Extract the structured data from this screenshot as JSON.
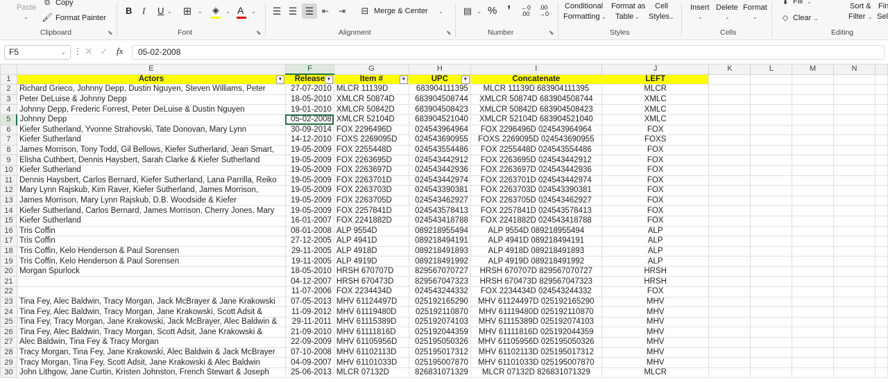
{
  "ribbon": {
    "clipboard": {
      "label": "Clipboard",
      "paste": "Paste",
      "copy": "Copy",
      "format_painter": "Format Painter"
    },
    "font": {
      "label": "Font",
      "bold": "B",
      "italic": "I",
      "underline": "U"
    },
    "alignment": {
      "label": "Alignment",
      "merge_center": "Merge & Center"
    },
    "number": {
      "label": "Number",
      "percent": "%",
      "comma": "ʼ"
    },
    "styles": {
      "label": "Styles",
      "conditional_1": "Conditional",
      "conditional_2": "Formatting",
      "format_as_1": "Format as",
      "format_as_2": "Table",
      "cell_1": "Cell",
      "cell_2": "Styles"
    },
    "cells": {
      "label": "Cells",
      "insert": "Insert",
      "delete": "Delete",
      "format": "Format"
    },
    "editing": {
      "label": "Editing",
      "fill": "Fill",
      "clear": "Clear",
      "sort_1": "Sort &",
      "sort_2": "Filter",
      "find_1": "Fin",
      "find_2": "Sel"
    }
  },
  "formula_bar": {
    "name_box": "F5",
    "fx": "fx",
    "value": "05-02-2008"
  },
  "columns": [
    "E",
    "F",
    "G",
    "H",
    "I",
    "J",
    "K",
    "L",
    "M",
    "N"
  ],
  "header_row": {
    "row": "1",
    "cells": [
      "Actors",
      "Release",
      "Item #",
      "UPC",
      "Concatenate",
      "LEFT"
    ]
  },
  "rows": [
    {
      "n": "2",
      "E": "Richard Grieco, Johnny Depp, Dustin Nguyen, Steven Williams, Peter",
      "F": "27-07-2010",
      "G": "MLCR 11139D",
      "H": "683904111395",
      "I": "MLCR 11139D 683904111395",
      "J": "MLCR"
    },
    {
      "n": "3",
      "E": "Peter DeLuise & Johnny Depp",
      "F": "18-05-2010",
      "G": "XMLCR 50874D",
      "H": "683904508744",
      "I": "XMLCR 50874D 683904508744",
      "J": "XMLC"
    },
    {
      "n": "4",
      "E": "Johnny Depp, Frederic Forrest, Peter DeLuise & Dustin Nguyen",
      "F": "19-01-2010",
      "G": "XMLCR 50842D",
      "H": "683904508423",
      "I": "XMLCR 50842D 683904508423",
      "J": "XMLC"
    },
    {
      "n": "5",
      "E": "Johnny Depp",
      "F": "05-02-2008",
      "G": "XMLCR 52104D",
      "H": "683904521040",
      "I": "XMLCR 52104D 683904521040",
      "J": "XMLC"
    },
    {
      "n": "6",
      "E": "Kiefer Sutherland, Yvonne Strahovski, Tate Donovan, Mary Lynn",
      "F": "30-09-2014",
      "G": "FOX 2296496D",
      "H": "024543964964",
      "I": "FOX 2296496D 024543964964",
      "J": "FOX"
    },
    {
      "n": "7",
      "E": "Kiefer Sutherland",
      "F": "14-12-2010",
      "G": "FOXS 2269095D",
      "H": "024543690955",
      "I": "FOXS 2269095D 024543690955",
      "J": "FOXS"
    },
    {
      "n": "8",
      "E": "James Morrison, Tony Todd, Gil Bellows, Kiefer Sutherland, Jean Smart,",
      "F": "19-05-2009",
      "G": "FOX 2255448D",
      "H": "024543554486",
      "I": "FOX 2255448D 024543554486",
      "J": "FOX"
    },
    {
      "n": "9",
      "E": "Elisha Cuthbert, Dennis Haysbert, Sarah Clarke & Kiefer Sutherland",
      "F": "19-05-2009",
      "G": "FOX 2263695D",
      "H": "024543442912",
      "I": "FOX 2263695D 024543442912",
      "J": "FOX"
    },
    {
      "n": "10",
      "E": "Kiefer Sutherland",
      "F": "19-05-2009",
      "G": "FOX 2263697D",
      "H": "024543442936",
      "I": "FOX 2263697D 024543442936",
      "J": "FOX"
    },
    {
      "n": "11",
      "E": "Dennis Haysbert, Carlos Bernard, Kiefer Sutherland, Lana Parrilla, Reiko",
      "F": "19-05-2009",
      "G": "FOX 2263701D",
      "H": "024543442974",
      "I": "FOX 2263701D 024543442974",
      "J": "FOX"
    },
    {
      "n": "12",
      "E": "Mary Lynn Rajskub, Kim Raver, Kiefer Sutherland, James Morrison,",
      "F": "19-05-2009",
      "G": "FOX 2263703D",
      "H": "024543390381",
      "I": "FOX 2263703D 024543390381",
      "J": "FOX"
    },
    {
      "n": "13",
      "E": "James Morrison, Mary Lynn Rajskub, D.B. Woodside & Kiefer",
      "F": "19-05-2009",
      "G": "FOX 2263705D",
      "H": "024543462927",
      "I": "FOX 2263705D 024543462927",
      "J": "FOX"
    },
    {
      "n": "14",
      "E": "Kiefer Sutherland, Carlos Bernard, James Morrison, Cherry Jones, Mary",
      "F": "19-05-2009",
      "G": "FOX 2257841D",
      "H": "024543578413",
      "I": "FOX 2257841D 024543578413",
      "J": "FOX"
    },
    {
      "n": "15",
      "E": "Kiefer Sutherland",
      "F": "16-01-2007",
      "G": "FOX 2241882D",
      "H": "024543418788",
      "I": "FOX 2241882D 024543418788",
      "J": "FOX"
    },
    {
      "n": "16",
      "E": "Tris Coffin",
      "F": "08-01-2008",
      "G": "ALP 9554D",
      "H": "089218955494",
      "I": "ALP 9554D 089218955494",
      "J": "ALP"
    },
    {
      "n": "17",
      "E": "Tris Coffin",
      "F": "27-12-2005",
      "G": "ALP 4941D",
      "H": "089218494191",
      "I": "ALP 4941D 089218494191",
      "J": "ALP"
    },
    {
      "n": "18",
      "E": "Tris Coffin, Kelo Henderson & Paul Sorensen",
      "F": "29-11-2005",
      "G": "ALP 4918D",
      "H": "089218491893",
      "I": "ALP 4918D 089218491893",
      "J": "ALP"
    },
    {
      "n": "19",
      "E": "Tris Coffin, Kelo Henderson & Paul Sorensen",
      "F": "19-11-2005",
      "G": "ALP 4919D",
      "H": "089218491992",
      "I": "ALP 4919D 089218491992",
      "J": "ALP"
    },
    {
      "n": "20",
      "E": "Morgan Spurlock",
      "F": "18-05-2010",
      "G": "HRSH 670707D",
      "H": "829567070727",
      "I": "HRSH 670707D 829567070727",
      "J": "HRSH"
    },
    {
      "n": "21",
      "E": "",
      "F": "04-12-2007",
      "G": "HRSH 670473D",
      "H": "829567047323",
      "I": "HRSH 670473D 829567047323",
      "J": "HRSH"
    },
    {
      "n": "22",
      "E": "",
      "F": "11-07-2006",
      "G": "FOX 2234434D",
      "H": "024543244332",
      "I": "FOX 2234434D 024543244332",
      "J": "FOX"
    },
    {
      "n": "23",
      "E": "Tina Fey, Alec Baldwin, Tracy Morgan, Jack McBrayer & Jane Krakowski",
      "F": "07-05-2013",
      "G": "MHV 61124497D",
      "H": "025192165290",
      "I": "MHV 61124497D 025192165290",
      "J": "MHV"
    },
    {
      "n": "24",
      "E": "Tina Fey, Alec Baldwin, Tracy Morgan, Jane Krakowski, Scott Adsit &",
      "F": "11-09-2012",
      "G": "MHV 61119480D",
      "H": "025192110870",
      "I": "MHV 61119480D 025192110870",
      "J": "MHV"
    },
    {
      "n": "25",
      "E": "Tina Fey, Tracy Morgan, Jane Krakowski, Jack McBrayer, Alec Baldwin &",
      "F": "29-11-2011",
      "G": "MHV 61115389D",
      "H": "025192074103",
      "I": "MHV 61115389D 025192074103",
      "J": "MHV"
    },
    {
      "n": "26",
      "E": "Tina Fey, Alec Baldwin, Tracy Morgan, Scott Adsit, Jane Krakowski &",
      "F": "21-09-2010",
      "G": "MHV 61111816D",
      "H": "025192044359",
      "I": "MHV 61111816D 025192044359",
      "J": "MHV"
    },
    {
      "n": "27",
      "E": "Alec Baldwin, Tina Fey & Tracy Morgan",
      "F": "22-09-2009",
      "G": "MHV 61105956D",
      "H": "025195050326",
      "I": "MHV 61105956D 025195050326",
      "J": "MHV"
    },
    {
      "n": "28",
      "E": "Tracy Morgan, Tina Fey, Jane Krakowski, Alec Baldwin & Jack McBrayer",
      "F": "07-10-2008",
      "G": "MHV 61102113D",
      "H": "025195017312",
      "I": "MHV 61102113D 025195017312",
      "J": "MHV"
    },
    {
      "n": "29",
      "E": "Tracy Morgan, Tina Fey, Scott Adsit, Jane Krakowski & Alec Baldwin",
      "F": "04-09-2007",
      "G": "MHV 61101033D",
      "H": "025195007870",
      "I": "MHV 61101033D 025195007870",
      "J": "MHV"
    },
    {
      "n": "30",
      "E": "John Lithgow, Jane Curtin, Kristen Johnston, French Stewart & Joseph",
      "F": "25-06-2013",
      "G": "MLCR 07132D",
      "H": "826831071329",
      "I": "MLCR 07132D 826831071329",
      "J": "MLCR"
    }
  ],
  "selection": {
    "row": "5",
    "column": "F"
  },
  "colors": {
    "header_fill": "#ffff00",
    "selection": "#217346"
  }
}
